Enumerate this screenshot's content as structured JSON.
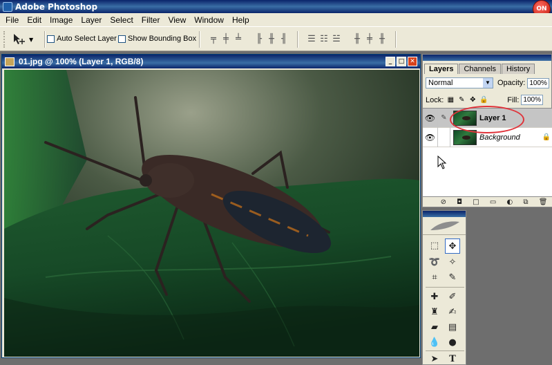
{
  "app": {
    "title": "Adobe Photoshop",
    "on_badge": "ON"
  },
  "menu": [
    "File",
    "Edit",
    "Image",
    "Layer",
    "Select",
    "Filter",
    "View",
    "Window",
    "Help"
  ],
  "options": {
    "auto_select_label": "Auto Select Layer",
    "bounding_box_label": "Show Bounding Box"
  },
  "document": {
    "title": "01.jpg @ 100% (Layer 1, RGB/8)"
  },
  "layers_panel": {
    "tabs": [
      "Layers",
      "Channels",
      "History"
    ],
    "active_tab": "Layers",
    "blend_mode": "Normal",
    "opacity_label": "Opacity:",
    "opacity": "100%",
    "lock_label": "Lock:",
    "fill_label": "Fill:",
    "fill": "100%",
    "layers": [
      {
        "name": "Layer 1",
        "selected": true
      },
      {
        "name": "Background",
        "selected": false
      }
    ]
  },
  "colors": {
    "accent": "#0a246a",
    "annotation": "#e0333a",
    "chrome": "#ece9d8"
  }
}
